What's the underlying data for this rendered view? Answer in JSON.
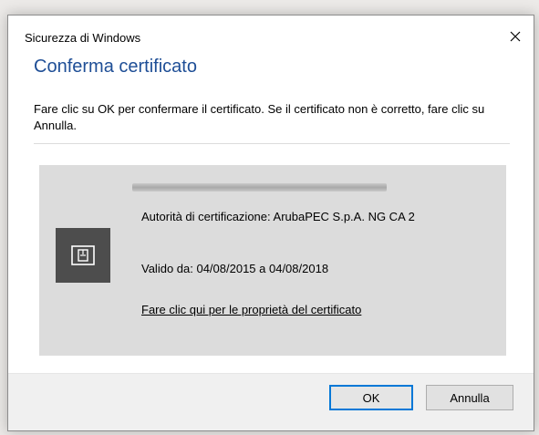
{
  "window": {
    "title": "Sicurezza di Windows",
    "close_icon": "close-icon"
  },
  "main": {
    "heading": "Conferma certificato",
    "description": "Fare clic su OK per confermare il certificato. Se il certificato non è corretto, fare clic su Annulla."
  },
  "certificate": {
    "icon": "certificate-icon",
    "issuer": "Autorità di certificazione: ArubaPEC S.p.A. NG CA 2",
    "validity": "Valido da: 04/08/2015 a 04/08/2018",
    "properties_link": "Fare clic qui per le proprietà del certificato"
  },
  "buttons": {
    "ok_label": "OK",
    "cancel_label": "Annulla"
  },
  "colors": {
    "heading": "#1e4e96",
    "accent": "#0078d7",
    "panel": "#dcdcdc",
    "icon_tile": "#4d4d4d"
  }
}
